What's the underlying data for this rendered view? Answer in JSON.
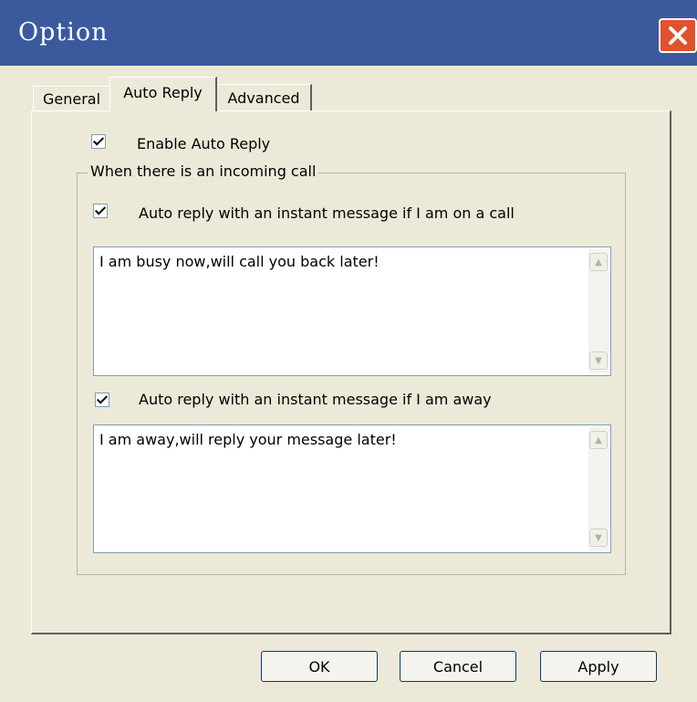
{
  "window": {
    "title": "Option"
  },
  "tabs": [
    {
      "label": "General",
      "selected": false
    },
    {
      "label": "Auto Reply",
      "selected": true
    },
    {
      "label": "Advanced",
      "selected": false
    }
  ],
  "auto_reply": {
    "enable": {
      "label": "Enable Auto Reply",
      "checked": true
    },
    "group_label": "When there is an incoming call",
    "on_call": {
      "label": "Auto reply with an instant message if I am on a call",
      "checked": true,
      "message": "I am busy now,will call  you back  later!"
    },
    "away": {
      "label": "Auto reply with an instant message if I am away",
      "checked": true,
      "message": "I am away,will reply your message later!"
    }
  },
  "buttons": {
    "ok": "OK",
    "cancel": "Cancel",
    "apply": "Apply"
  },
  "icons": {
    "close": "close-icon",
    "scroll_up": "scroll-up-arrow-icon",
    "scroll_down": "scroll-down-arrow-icon"
  },
  "colors": {
    "titlebar": "#3b5a9e",
    "close_button": "#e0522d",
    "dialog_bg": "#ece9d8",
    "field_border": "#7f9db9"
  }
}
